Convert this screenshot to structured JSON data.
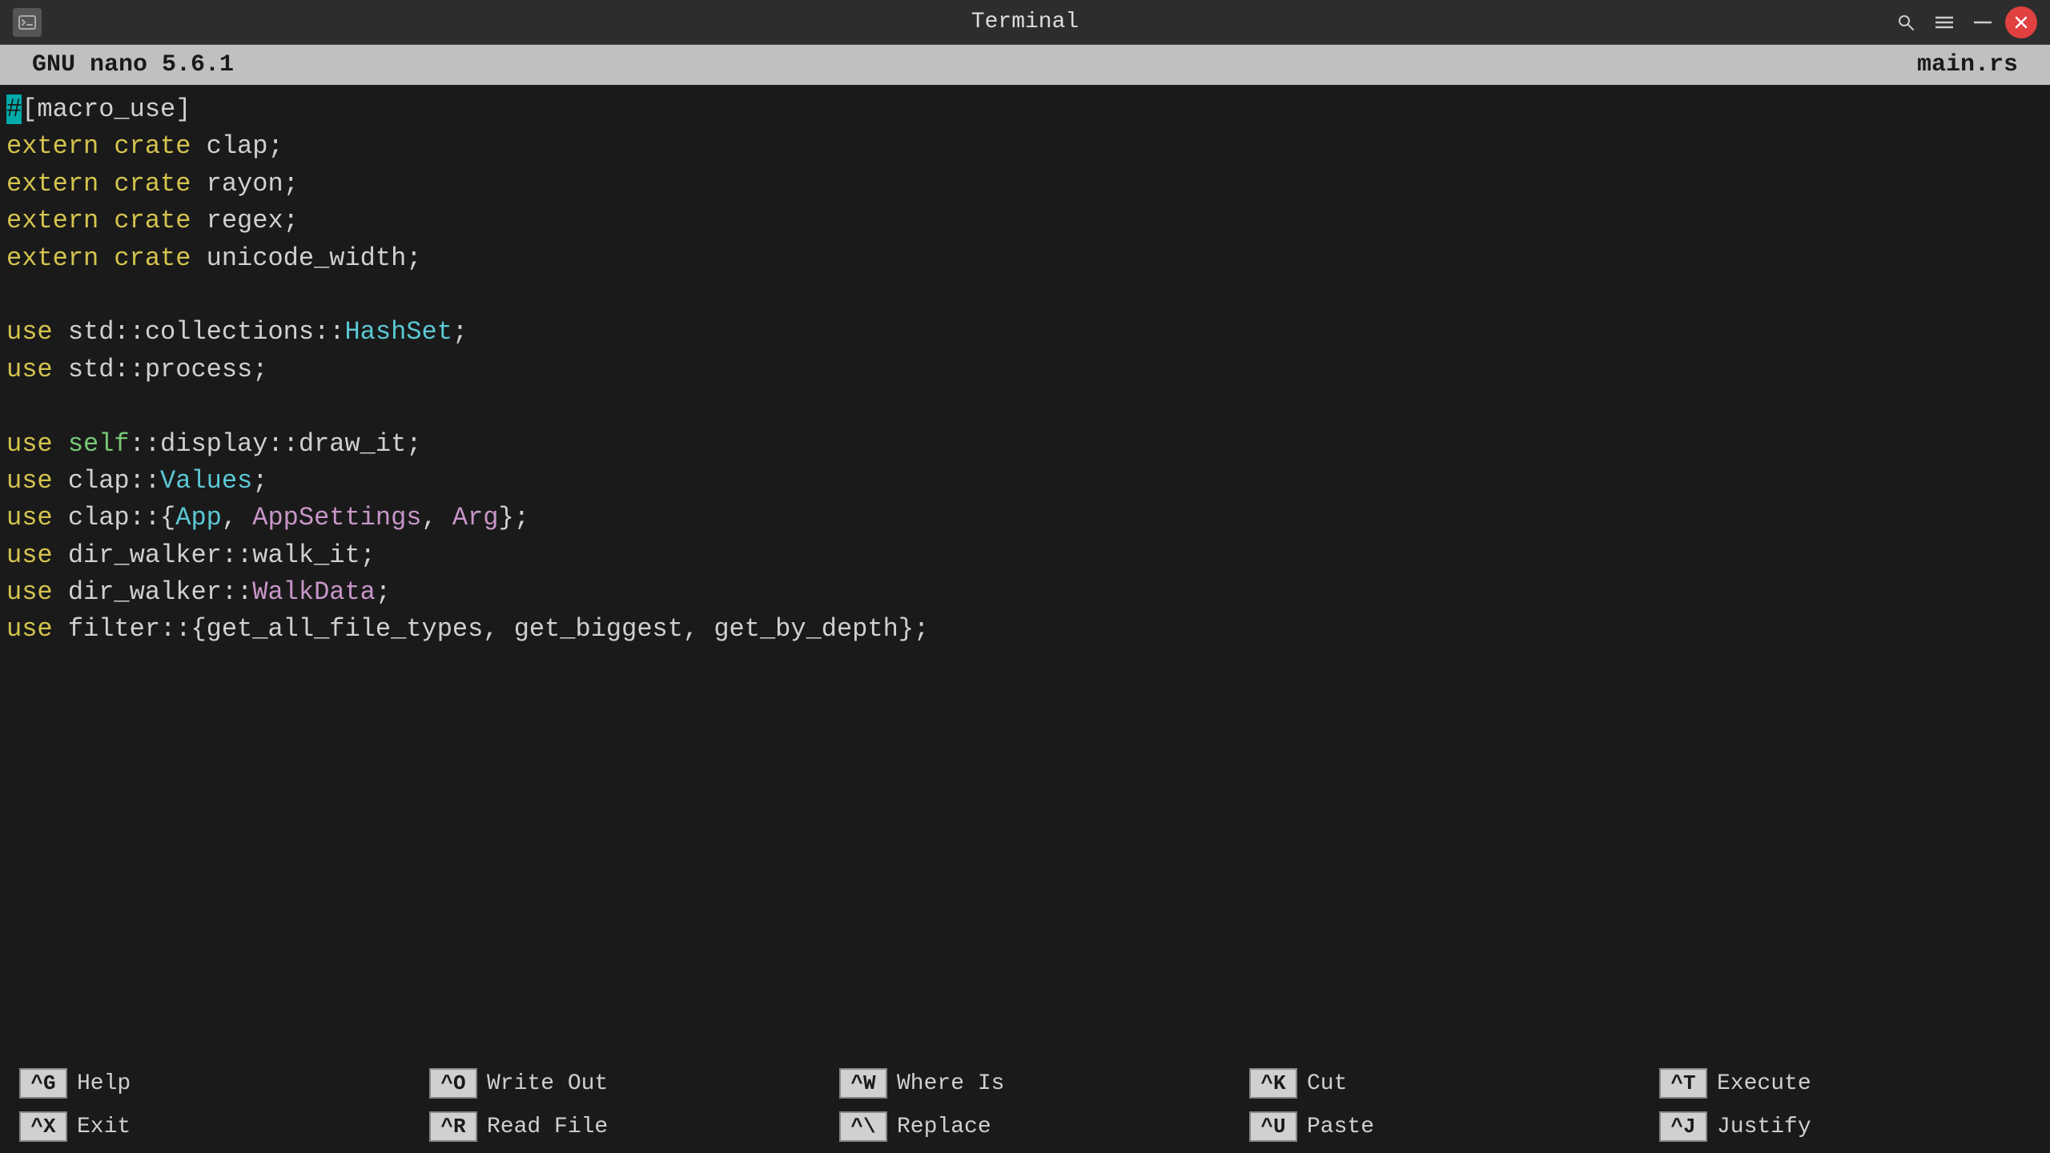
{
  "titlebar": {
    "app_icon": "▤",
    "title": "Terminal",
    "search_icon": "🔍",
    "menu_icon": "☰",
    "minimize_icon": "−",
    "close_icon": "✕"
  },
  "nano_header": {
    "left": "GNU nano 5.6.1",
    "right": "main.rs"
  },
  "code_lines": [
    {
      "id": 1,
      "text": "#[macro_use]",
      "parts": [
        {
          "text": "#",
          "color": "cyan"
        },
        {
          "text": "[macro_use]",
          "color": "white"
        }
      ]
    },
    {
      "id": 2,
      "text": "extern crate clap;",
      "parts": [
        {
          "text": "extern",
          "color": "yellow"
        },
        {
          "text": " ",
          "color": "white"
        },
        {
          "text": "crate",
          "color": "yellow"
        },
        {
          "text": " clap;",
          "color": "white"
        }
      ]
    },
    {
      "id": 3,
      "text": "extern crate rayon;",
      "parts": [
        {
          "text": "extern",
          "color": "yellow"
        },
        {
          "text": " ",
          "color": "white"
        },
        {
          "text": "crate",
          "color": "yellow"
        },
        {
          "text": " rayon;",
          "color": "white"
        }
      ]
    },
    {
      "id": 4,
      "text": "extern crate regex;",
      "parts": [
        {
          "text": "extern",
          "color": "yellow"
        },
        {
          "text": " ",
          "color": "white"
        },
        {
          "text": "crate",
          "color": "yellow"
        },
        {
          "text": " regex;",
          "color": "white"
        }
      ]
    },
    {
      "id": 5,
      "text": "extern crate unicode_width;",
      "parts": [
        {
          "text": "extern",
          "color": "yellow"
        },
        {
          "text": " ",
          "color": "white"
        },
        {
          "text": "crate",
          "color": "yellow"
        },
        {
          "text": " unicode_width;",
          "color": "white"
        }
      ]
    },
    {
      "id": 6,
      "text": ""
    },
    {
      "id": 7,
      "text": "use std::collections::HashSet;",
      "parts": [
        {
          "text": "use",
          "color": "yellow"
        },
        {
          "text": " std::collections::",
          "color": "white"
        },
        {
          "text": "HashSet",
          "color": "cyan"
        },
        {
          "text": ";",
          "color": "white"
        }
      ]
    },
    {
      "id": 8,
      "text": "use std::process;",
      "parts": [
        {
          "text": "use",
          "color": "yellow"
        },
        {
          "text": " std::process;",
          "color": "white"
        }
      ]
    },
    {
      "id": 9,
      "text": ""
    },
    {
      "id": 10,
      "text": "use self::display::draw_it;",
      "parts": [
        {
          "text": "use",
          "color": "yellow"
        },
        {
          "text": " ",
          "color": "white"
        },
        {
          "text": "self",
          "color": "green"
        },
        {
          "text": "::display::draw_it;",
          "color": "white"
        }
      ]
    },
    {
      "id": 11,
      "text": "use clap::Values;",
      "parts": [
        {
          "text": "use",
          "color": "yellow"
        },
        {
          "text": " clap::",
          "color": "white"
        },
        {
          "text": "Values",
          "color": "cyan"
        },
        {
          "text": ";",
          "color": "white"
        }
      ]
    },
    {
      "id": 12,
      "text": "use clap::{App, AppSettings, Arg};",
      "parts": [
        {
          "text": "use",
          "color": "yellow"
        },
        {
          "text": " clap::{",
          "color": "white"
        },
        {
          "text": "App",
          "color": "cyan"
        },
        {
          "text": ", ",
          "color": "white"
        },
        {
          "text": "AppSettings",
          "color": "purple"
        },
        {
          "text": ", ",
          "color": "white"
        },
        {
          "text": "Arg",
          "color": "purple"
        },
        {
          "text": "};",
          "color": "white"
        }
      ]
    },
    {
      "id": 13,
      "text": "use dir_walker::walk_it;",
      "parts": [
        {
          "text": "use",
          "color": "yellow"
        },
        {
          "text": " dir_walker::walk_it;",
          "color": "white"
        }
      ]
    },
    {
      "id": 14,
      "text": "use dir_walker::WalkData;",
      "parts": [
        {
          "text": "use",
          "color": "yellow"
        },
        {
          "text": " dir_walker::",
          "color": "white"
        },
        {
          "text": "WalkData",
          "color": "purple"
        },
        {
          "text": ";",
          "color": "white"
        }
      ]
    },
    {
      "id": 15,
      "text": "use filter::{get_all_file_types, get_biggest, get_by_depth};",
      "parts": [
        {
          "text": "use",
          "color": "yellow"
        },
        {
          "text": " filter::{get_all_file_types, get_biggest, get_by_depth};",
          "color": "white"
        }
      ]
    }
  ],
  "shortcuts": [
    {
      "row1": {
        "key": "^G",
        "label": "Help"
      },
      "row2": {
        "key": "^X",
        "label": "Exit"
      }
    },
    {
      "row1": {
        "key": "^O",
        "label": "Write Out"
      },
      "row2": {
        "key": "^R",
        "label": "Read File"
      }
    },
    {
      "row1": {
        "key": "^W",
        "label": "Where Is"
      },
      "row2": {
        "key": "^\\",
        "label": "Replace"
      }
    },
    {
      "row1": {
        "key": "^K",
        "label": "Cut"
      },
      "row2": {
        "key": "^U",
        "label": "Paste"
      }
    },
    {
      "row1": {
        "key": "^T",
        "label": "Execute"
      },
      "row2": {
        "key": "^J",
        "label": "Justify"
      }
    }
  ]
}
